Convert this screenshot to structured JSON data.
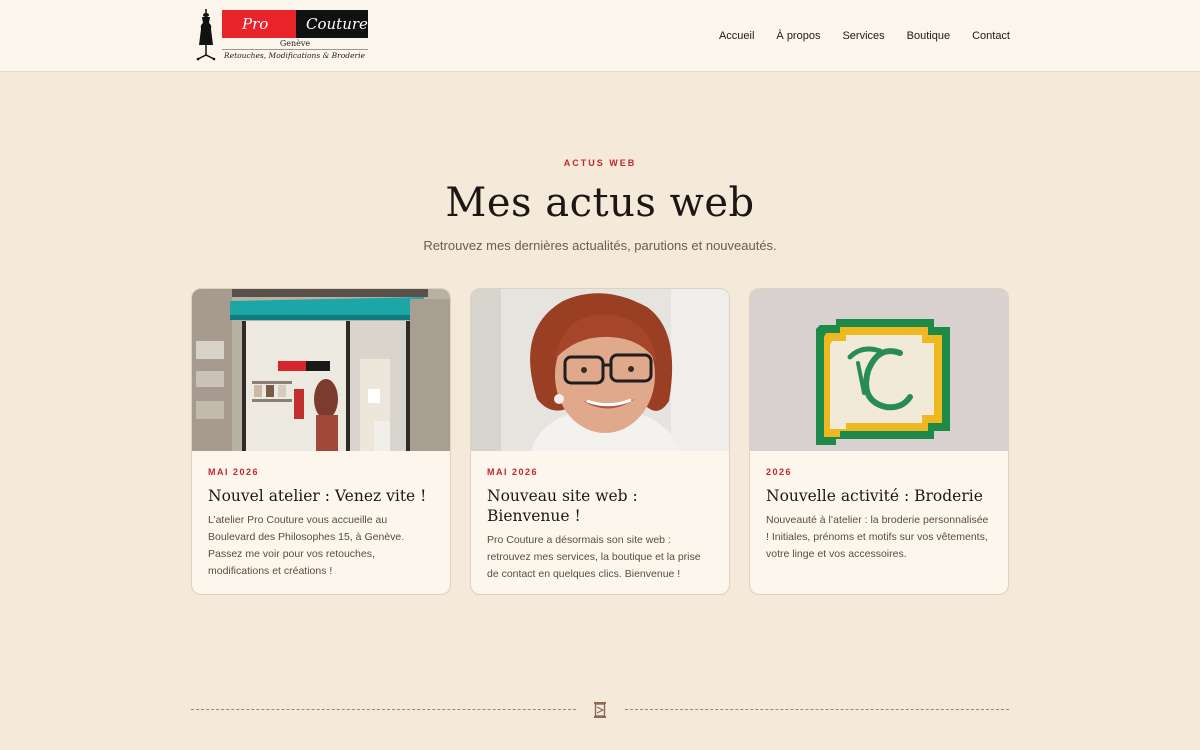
{
  "brand": {
    "name_left": "Pro",
    "name_right": "Couture",
    "city": "Genève",
    "tagline": "Retouches, Modifications & Broderie"
  },
  "nav": {
    "items": [
      "Accueil",
      "À propos",
      "Services",
      "Boutique",
      "Contact"
    ]
  },
  "section": {
    "eyebrow": "ACTUS WEB",
    "title": "Mes actus web",
    "subtitle": "Retrouvez mes dernières actualités, parutions et nouveautés."
  },
  "cards": [
    {
      "date": "MAI 2026",
      "title": "Nouvel atelier : Venez vite !",
      "text": "L’atelier Pro Couture vous accueille au Boulevard des Philosophes 15, à Genève. Passez me voir pour vos retouches, modifications et créations !",
      "image": "shop-front-photo"
    },
    {
      "date": "MAI 2026",
      "title": "Nouveau site web : Bienvenue !",
      "text": "Pro Couture a désormais son site web : retrouvez mes services, la boutique et la prise de contact en quelques clics. Bienvenue !",
      "image": "portrait-photo"
    },
    {
      "date": "2026",
      "title": "Nouvelle activité : Broderie",
      "text": "Nouveauté à l’atelier : la broderie personnalisée ! Initiales, prénoms et motifs sur vos vêtements, votre linge et vos accessoires.",
      "image": "embroidery-photo"
    }
  ],
  "colors": {
    "accent": "#c5262c",
    "background": "#f5ead9",
    "card": "#fcf6ec",
    "divider": "#b08160"
  }
}
